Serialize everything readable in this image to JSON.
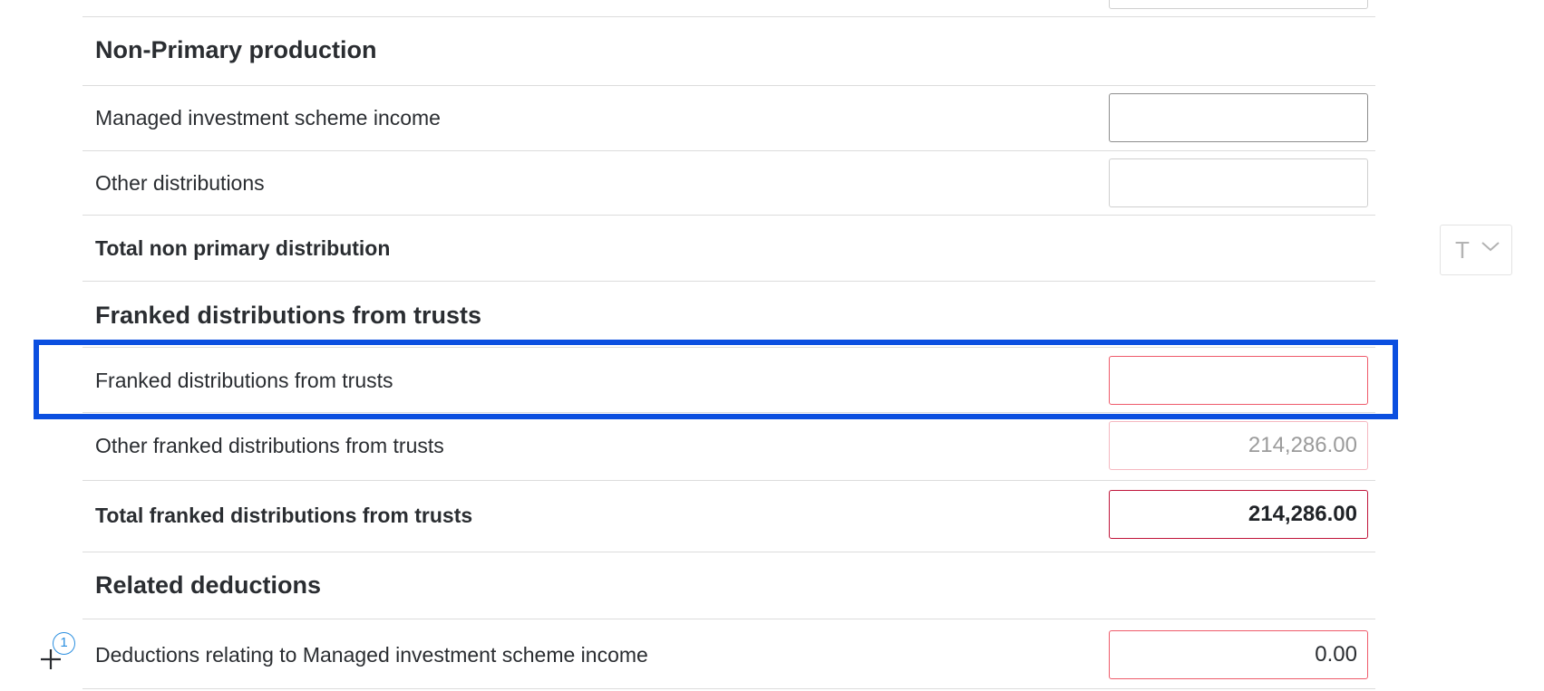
{
  "sections": {
    "non_primary": {
      "heading": "Non-Primary production",
      "rows": [
        {
          "label": "Managed investment scheme income",
          "value": ""
        },
        {
          "label": "Other distributions",
          "value": ""
        }
      ],
      "total_label": "Total non primary distribution"
    },
    "franked": {
      "heading": "Franked distributions from trusts",
      "rows": [
        {
          "label": "Franked distributions from trusts",
          "value": ""
        },
        {
          "label": "Other franked distributions from trusts",
          "value": "214,286.00"
        }
      ],
      "total_label": "Total franked distributions from trusts",
      "total_value": "214,286.00"
    },
    "deductions": {
      "heading": "Related deductions",
      "rows": [
        {
          "label": "Deductions relating to Managed investment scheme income",
          "value": "0.00"
        }
      ]
    }
  },
  "side_select": {
    "label": "T"
  },
  "comment": {
    "count": "1"
  },
  "colors": {
    "highlight": "#0b4fe0",
    "error_border": "#ef5a6a",
    "total_border": "#c0153a"
  }
}
